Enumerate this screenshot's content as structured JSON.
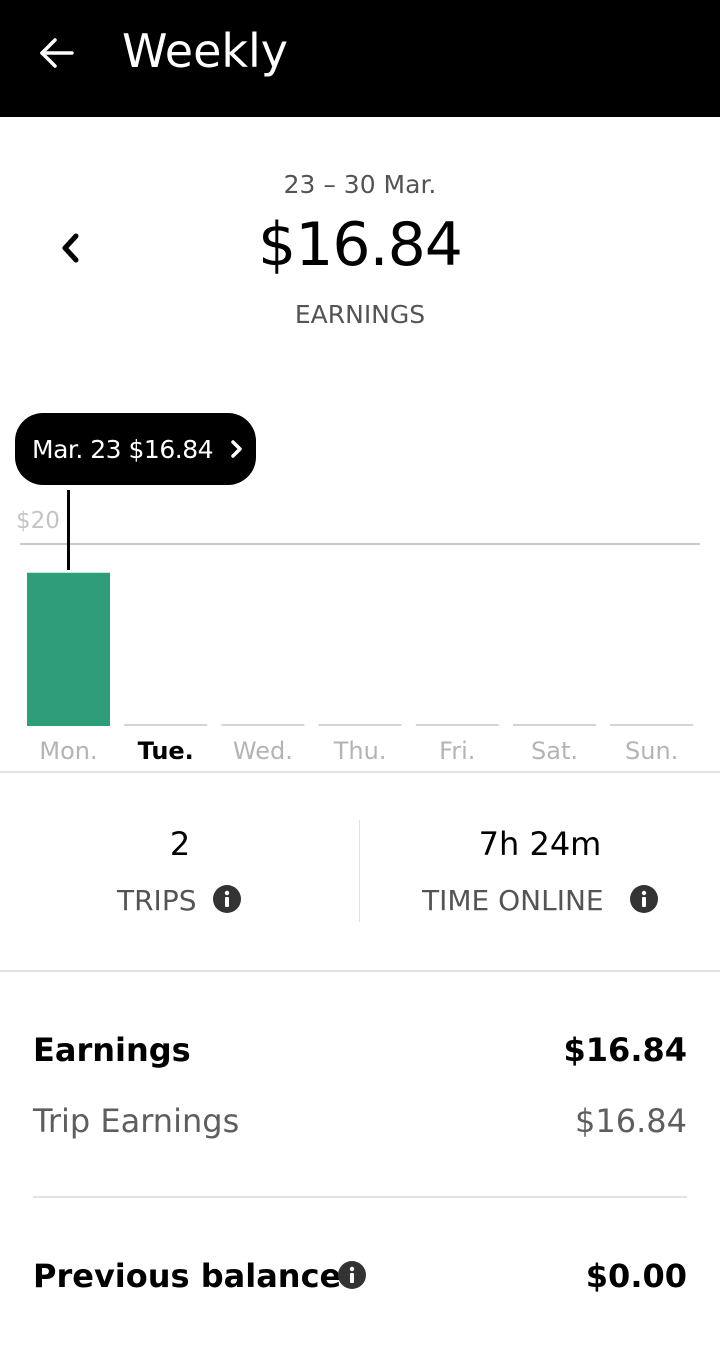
{
  "header": {
    "title": "Weekly",
    "back_icon": "arrow-left-icon"
  },
  "summary": {
    "date_range": "23 – 30 Mar.",
    "total": "$16.84",
    "label": "EARNINGS",
    "prev_icon": "chevron-left-icon"
  },
  "chart_data": {
    "type": "bar",
    "categories": [
      "Mon.",
      "Tue.",
      "Wed.",
      "Thu.",
      "Fri.",
      "Sat.",
      "Sun."
    ],
    "values": [
      16.84,
      0,
      0,
      0,
      0,
      0,
      0
    ],
    "ylim": [
      0,
      20
    ],
    "gridline_label": "$20",
    "selected_category": "Tue.",
    "bar_color": "#2e9e7a",
    "empty_bar_color": "#d4d4d4",
    "tooltip": {
      "text": "Mar. 23 $16.84",
      "icon": "chevron-right-icon"
    }
  },
  "stats": {
    "trips_value": "2",
    "trips_label": "TRIPS",
    "time_value": "7h 24m",
    "time_label": "TIME ONLINE",
    "info_icon": "info-icon"
  },
  "breakdown": {
    "earnings_label": "Earnings",
    "earnings_value": "$16.84",
    "trip_earnings_label": "Trip Earnings",
    "trip_earnings_value": "$16.84",
    "previous_balance_label": "Previous balance",
    "previous_balance_value": "$0.00"
  }
}
